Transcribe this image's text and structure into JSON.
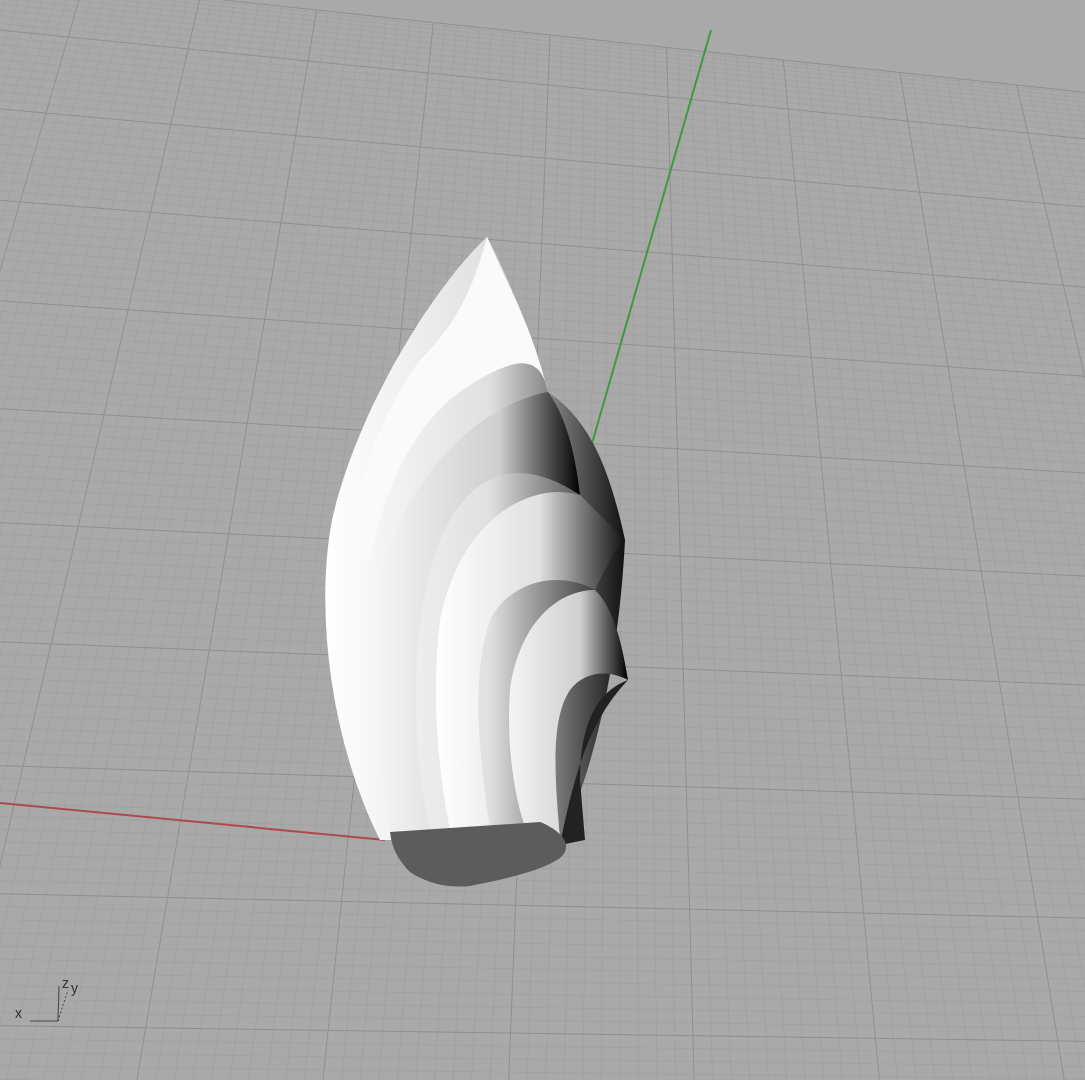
{
  "viewport": {
    "axis_labels": [
      "x",
      "z",
      "y"
    ]
  }
}
